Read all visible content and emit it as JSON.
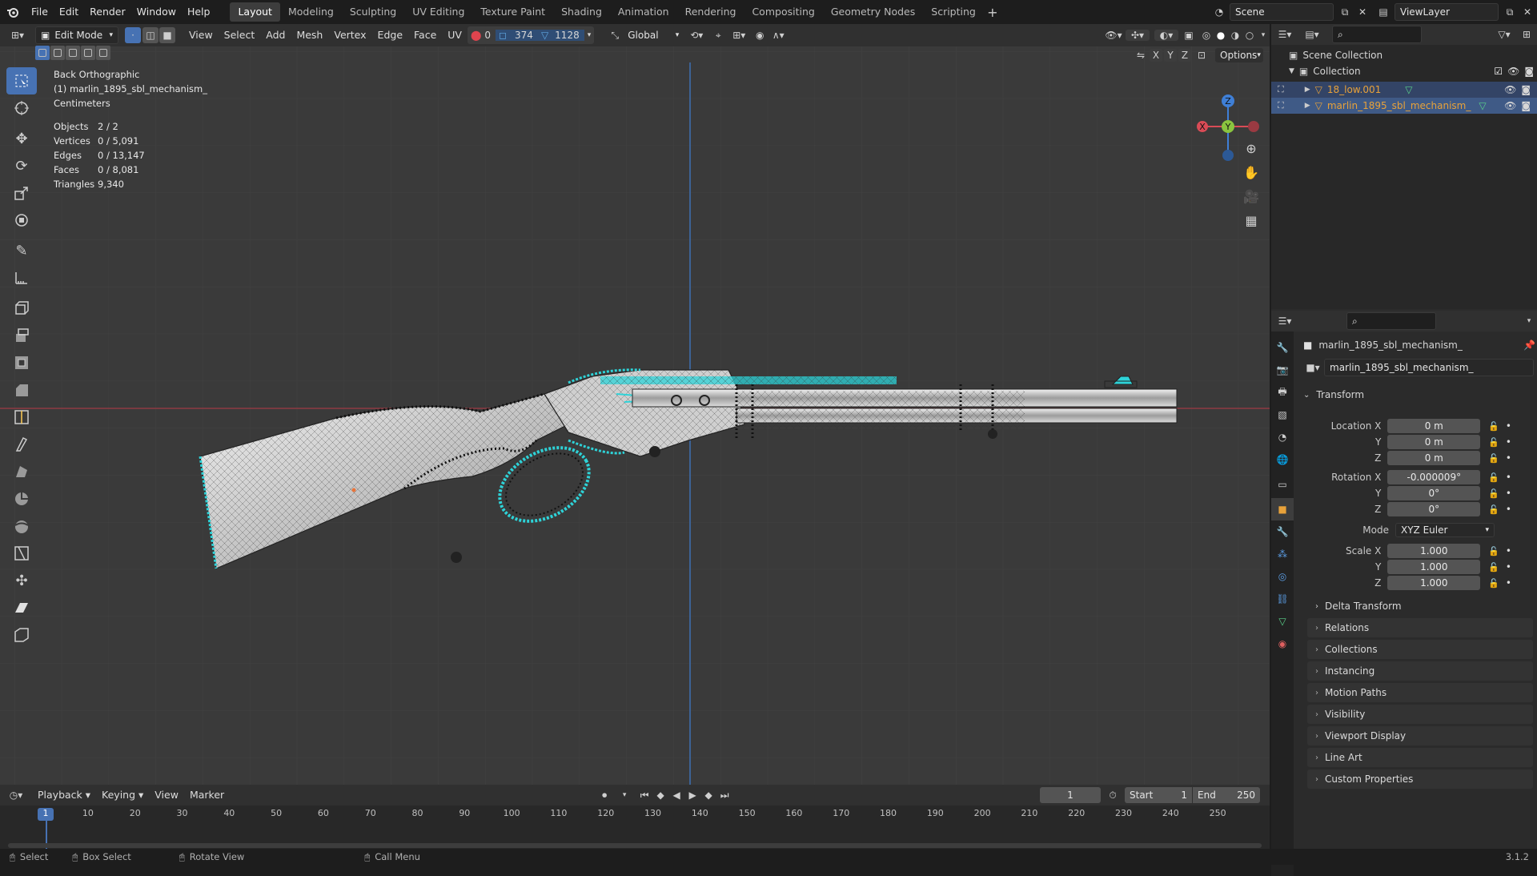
{
  "menu": [
    "File",
    "Edit",
    "Render",
    "Window",
    "Help"
  ],
  "workspaces": [
    "Layout",
    "Modeling",
    "Sculpting",
    "UV Editing",
    "Texture Paint",
    "Shading",
    "Animation",
    "Rendering",
    "Compositing",
    "Geometry Nodes",
    "Scripting"
  ],
  "active_workspace": "Layout",
  "scene_name": "Scene",
  "viewlayer_name": "ViewLayer",
  "viewport_header": {
    "mode": "Edit Mode",
    "menus": [
      "View",
      "Select",
      "Add",
      "Mesh",
      "Vertex",
      "Edge",
      "Face",
      "UV"
    ],
    "sel_vertices": "0",
    "sel_edges": "374",
    "sel_faces": "1128",
    "orientation": "Global",
    "options_label": "Options",
    "axes": [
      "X",
      "Y",
      "Z"
    ]
  },
  "overlay": {
    "view_name": "Back Orthographic",
    "object_name": "(1) marlin_1895_sbl_mechanism_",
    "units": "Centimeters",
    "stats": [
      {
        "label": "Objects",
        "value": "2 / 2"
      },
      {
        "label": "Vertices",
        "value": "0 / 5,091"
      },
      {
        "label": "Edges",
        "value": "0 / 13,147"
      },
      {
        "label": "Faces",
        "value": "0 / 8,081"
      },
      {
        "label": "Triangles",
        "value": "9,340"
      }
    ]
  },
  "gizmo": {
    "z": "Z",
    "y": "Y",
    "x": "X"
  },
  "outliner": {
    "scene_collection": "Scene Collection",
    "collection": "Collection",
    "objects": [
      {
        "name": "18_low.001",
        "color": "#e8a23a"
      },
      {
        "name": "marlin_1895_sbl_mechanism_",
        "color": "#e8a23a"
      }
    ]
  },
  "properties": {
    "object_name": "marlin_1895_sbl_mechanism_",
    "datablock_name": "marlin_1895_sbl_mechanism_",
    "transform_title": "Transform",
    "location": {
      "label": "Location X",
      "x": "0 m",
      "y": "0 m",
      "z": "0 m"
    },
    "rotation": {
      "label": "Rotation X",
      "x": "-0.000009°",
      "y": "0°",
      "z": "0°"
    },
    "mode_label": "Mode",
    "mode_value": "XYZ Euler",
    "scale": {
      "label": "Scale X",
      "x": "1.000",
      "y": "1.000",
      "z": "1.000"
    },
    "y_label": "Y",
    "z_label": "Z",
    "delta": "Delta Transform",
    "panels": [
      "Relations",
      "Collections",
      "Instancing",
      "Motion Paths",
      "Visibility",
      "Viewport Display",
      "Line Art",
      "Custom Properties"
    ]
  },
  "timeline": {
    "menus": [
      "Playback",
      "Keying",
      "View",
      "Marker"
    ],
    "current_frame": "1",
    "start_label": "Start",
    "start": "1",
    "end_label": "End",
    "end": "250",
    "ticks": [
      "1",
      "10",
      "20",
      "30",
      "40",
      "50",
      "60",
      "70",
      "80",
      "90",
      "100",
      "110",
      "120",
      "130",
      "140",
      "150",
      "160",
      "170",
      "180",
      "190",
      "200",
      "210",
      "220",
      "230",
      "240",
      "250"
    ]
  },
  "status": {
    "select": "Select",
    "box_select": "Box Select",
    "rotate_view": "Rotate View",
    "call_menu": "Call Menu",
    "version": "3.1.2"
  },
  "colors": {
    "accent": "#4772b3",
    "selection": "#2ed3d8",
    "x_axis": "#d94b56",
    "y_axis": "#8ac43f",
    "z_axis": "#3f7fd6"
  }
}
